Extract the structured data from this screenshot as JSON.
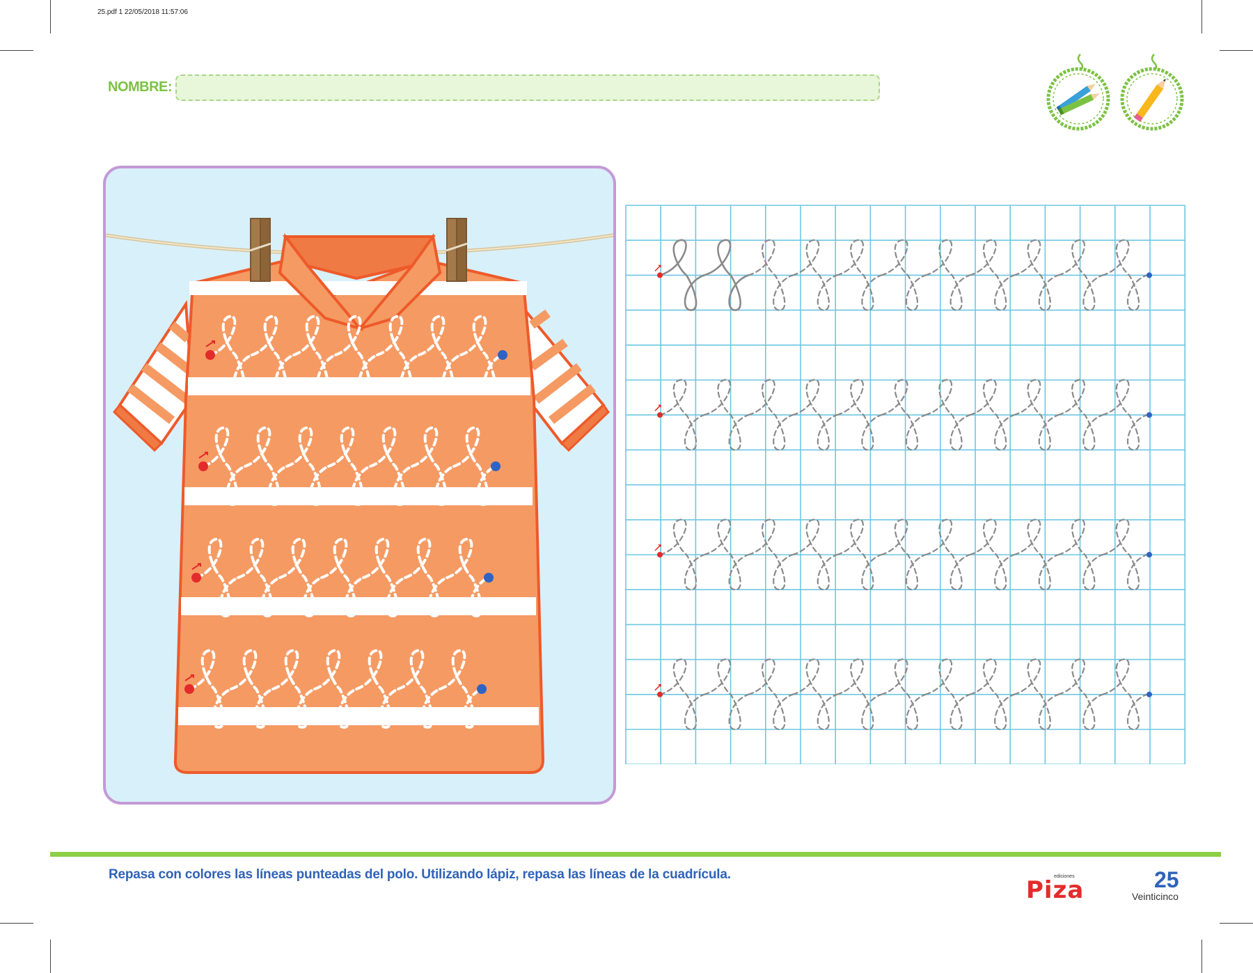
{
  "header": {
    "print_info": "25.pdf   1   22/05/2018   11:57:06"
  },
  "name_field": {
    "label": "NOMBRE:",
    "value": ""
  },
  "badges": [
    {
      "icon": "colored-pencils-icon"
    },
    {
      "icon": "pencil-icon"
    }
  ],
  "activity": {
    "shirt_color": "#f59a63",
    "shirt_outline": "#ee5a2a",
    "start_dot_color": "#e32b2b",
    "end_dot_color": "#2f63c4",
    "grid_color": "#6ec6e2",
    "trace_color": "#8a8a8a"
  },
  "footer": {
    "instructions": "Repasa con colores las líneas punteadas del polo. Utilizando lápiz, repasa las líneas de la cuadrícula.",
    "logo_small": "ediciones",
    "logo_main": "Piza",
    "page_number": "25",
    "page_word": "Veinticinco"
  }
}
